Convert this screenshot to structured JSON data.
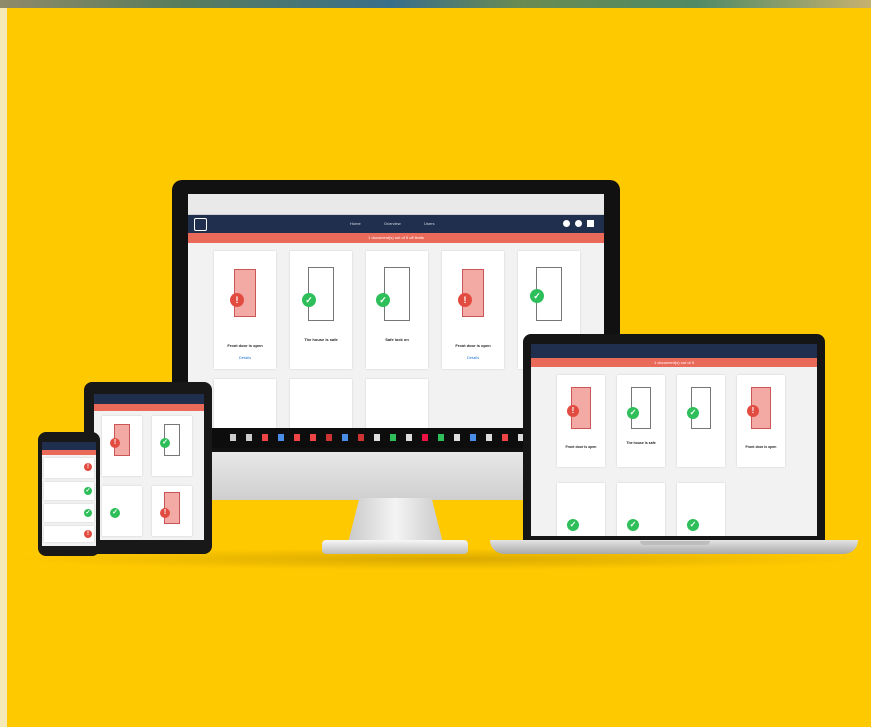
{
  "scene": {
    "background_color": "#ffc900",
    "accent_colors": {
      "nav": "#1f2f4d",
      "banner": "#ea6a5a",
      "ok": "#2ebf5a",
      "alert": "#e24c40"
    }
  },
  "monitor": {
    "nav_tabs": [
      "Home",
      "Overview",
      "Users"
    ],
    "banner_text": "1 document(s) out of 5 off limits",
    "cards": [
      {
        "status": "alert",
        "icon": "exclamation-icon",
        "title": "Front door is open",
        "link": "Details"
      },
      {
        "status": "ok",
        "icon": "check-icon",
        "title": "The house is safe"
      },
      {
        "status": "ok",
        "icon": "check-icon",
        "title": "Safe lock on"
      },
      {
        "status": "alert",
        "icon": "exclamation-icon",
        "title": "Front door is open",
        "link": "Details"
      },
      {
        "status": "ok",
        "icon": "check-icon",
        "title": ""
      }
    ]
  },
  "laptop": {
    "banner_text": "1 document(s) out of 5",
    "cards": [
      {
        "status": "alert",
        "title": "Front door is open"
      },
      {
        "status": "ok",
        "title": "The house is safe"
      },
      {
        "status": "ok",
        "title": ""
      },
      {
        "status": "alert",
        "title": "Front door is open"
      }
    ]
  }
}
